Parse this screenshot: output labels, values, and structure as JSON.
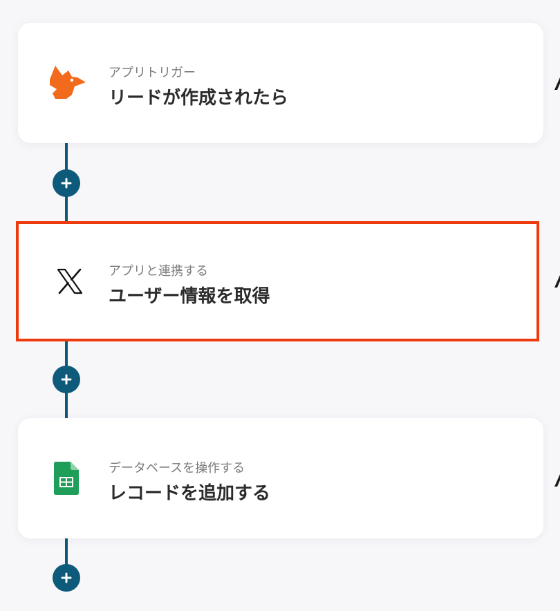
{
  "flow": {
    "steps": [
      {
        "subtitle": "アプリトリガー",
        "title": "リードが作成されたら",
        "icon": "fox-icon"
      },
      {
        "subtitle": "アプリと連携する",
        "title": "ユーザー情報を取得",
        "icon": "x-logo-icon"
      },
      {
        "subtitle": "データベースを操作する",
        "title": "レコードを追加する",
        "icon": "google-sheets-icon"
      }
    ]
  },
  "colors": {
    "background": "#f7f6f9",
    "connector": "#0d5a7a",
    "selected_border": "#ee3b0e",
    "fox": "#f26a1b",
    "sheets": "#1e9e58"
  }
}
